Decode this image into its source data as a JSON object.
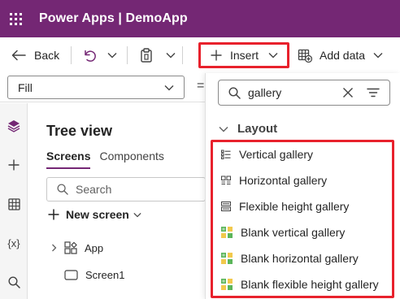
{
  "app": {
    "title": "Power Apps  |  DemoApp"
  },
  "toolbar": {
    "back_label": "Back",
    "insert_label": "Insert",
    "add_data_label": "Add data"
  },
  "formula_bar": {
    "property_value": "Fill",
    "equals_sign": "="
  },
  "tree_view": {
    "title": "Tree view",
    "tabs": [
      {
        "label": "Screens",
        "active": true
      },
      {
        "label": "Components",
        "active": false
      }
    ],
    "search_placeholder": "Search",
    "new_screen_label": "New screen",
    "nodes": [
      {
        "label": "App",
        "icon": "app-icon"
      },
      {
        "label": "Screen1",
        "icon": "screen-icon"
      }
    ]
  },
  "insert_panel": {
    "search_value": "gallery",
    "section_label": "Layout",
    "results": [
      {
        "label": "Vertical gallery",
        "icon": "vertical-gallery-icon"
      },
      {
        "label": "Horizontal gallery",
        "icon": "horizontal-gallery-icon"
      },
      {
        "label": "Flexible height gallery",
        "icon": "flexible-height-gallery-icon"
      },
      {
        "label": "Blank vertical gallery",
        "icon": "blank-vertical-gallery-icon"
      },
      {
        "label": "Blank horizontal gallery",
        "icon": "blank-horizontal-gallery-icon"
      },
      {
        "label": "Blank flexible height gallery",
        "icon": "blank-flexible-height-gallery-icon"
      }
    ]
  },
  "colors": {
    "brand": "#742774",
    "highlight": "#e8212c"
  }
}
